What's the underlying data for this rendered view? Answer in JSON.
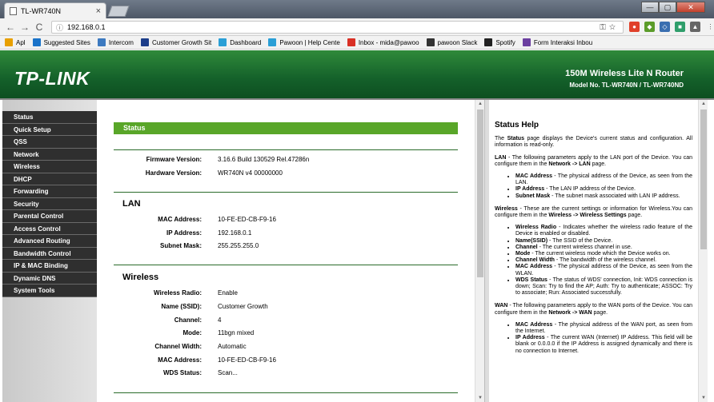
{
  "browser": {
    "tab_title": "TL-WR740N",
    "tab_close": "×",
    "url": "192.168.0.1",
    "win_min": "—",
    "win_max": "▢",
    "win_close": "✕",
    "bookmarks": [
      {
        "label": "Apl",
        "color": "#e8a000"
      },
      {
        "label": "Suggested Sites",
        "color": "#1a73c9"
      },
      {
        "label": "Intercom",
        "color": "#3d7ac0"
      },
      {
        "label": "Customer Growth Sit",
        "color": "#1d3e8a"
      },
      {
        "label": "Dashboard",
        "color": "#2a9fd6"
      },
      {
        "label": "Pawoon | Help Cente",
        "color": "#2a9fd6"
      },
      {
        "label": "Inbox - mida@pawoo",
        "color": "#d93025"
      },
      {
        "label": "pawoon Slack",
        "color": "#333333"
      },
      {
        "label": "Spotify",
        "color": "#222222"
      },
      {
        "label": "Form Interaksi Inbou",
        "color": "#6b3fa0"
      }
    ]
  },
  "header": {
    "logo": "TP-LINK",
    "model_line1": "150M Wireless Lite N Router",
    "model_line2": "Model No. TL-WR740N / TL-WR740ND"
  },
  "menu": [
    "Status",
    "Quick Setup",
    "QSS",
    "Network",
    "Wireless",
    "DHCP",
    "Forwarding",
    "Security",
    "Parental Control",
    "Access Control",
    "Advanced Routing",
    "Bandwidth Control",
    "IP & MAC Binding",
    "Dynamic DNS",
    "System Tools"
  ],
  "main": {
    "title": "Status",
    "firmware_label": "Firmware Version:",
    "firmware_value": "3.16.6 Build 130529 Rel.47286n",
    "hardware_label": "Hardware Version:",
    "hardware_value": "WR740N v4 00000000",
    "lan": {
      "title": "LAN",
      "mac_label": "MAC Address:",
      "mac_value": "10-FE-ED-CB-F9-16",
      "ip_label": "IP Address:",
      "ip_value": "192.168.0.1",
      "mask_label": "Subnet Mask:",
      "mask_value": "255.255.255.0"
    },
    "wireless": {
      "title": "Wireless",
      "radio_label": "Wireless Radio:",
      "radio_value": "Enable",
      "ssid_label": "Name (SSID):",
      "ssid_value": "Customer Growth",
      "channel_label": "Channel:",
      "channel_value": "4",
      "mode_label": "Mode:",
      "mode_value": "11bgn mixed",
      "width_label": "Channel Width:",
      "width_value": "Automatic",
      "mac_label": "MAC Address:",
      "mac_value": "10-FE-ED-CB-F9-16",
      "wds_label": "WDS Status:",
      "wds_value": "Scan..."
    }
  },
  "help": {
    "title": "Status Help",
    "intro_pre": "The ",
    "intro_bold": "Status",
    "intro_post": " page displays the Device's current status and configuration. All information is read-only.",
    "lan_pre": "LAN",
    "lan_text": " - The following parameters apply to the LAN port of the Device. You can configure them in the ",
    "lan_link": "Network -> LAN",
    "lan_end": " page.",
    "lan_items": [
      {
        "b": "MAC Address",
        "t": " - The physical address of the Device, as seen from the LAN."
      },
      {
        "b": "IP Address",
        "t": " - The LAN IP address of the Device."
      },
      {
        "b": "Subnet Mask",
        "t": " - The subnet mask associated with LAN IP address."
      }
    ],
    "wl_pre": "Wireless",
    "wl_text": " - These are the current settings or information for Wireless.You can configure them in the ",
    "wl_link": "Wireless -> Wireless Settings",
    "wl_end": " page.",
    "wl_items": [
      {
        "b": "Wireless Radio",
        "t": " - Indicates whether the wireless radio feature of the Device is enabled or disabled."
      },
      {
        "b": "Name(SSID)",
        "t": " - The SSID of the Device."
      },
      {
        "b": "Channel",
        "t": " - The current wireless channel in use."
      },
      {
        "b": "Mode",
        "t": " - The current wireless mode which the Device works on."
      },
      {
        "b": "Channel Width",
        "t": " - The bandwidth of the wireless channel."
      },
      {
        "b": "MAC Address",
        "t": " - The physical address of the Device, as seen from the WLAN."
      },
      {
        "b": "WDS Status",
        "t": " - The status of WDS' connection, Init: WDS connection is down; Scan: Try to find the AP; Auth: Try to authenticate; ASSOC: Try to associate; Run: Associated successfully."
      }
    ],
    "wan_pre": "WAN",
    "wan_text": " - The following parameters apply to the WAN ports of the Device. You can configure them in the ",
    "wan_link": "Network -> WAN",
    "wan_end": " page.",
    "wan_items": [
      {
        "b": "MAC Address",
        "t": " - The physical address of the WAN port, as seen from the Internet."
      },
      {
        "b": "IP Address",
        "t": " - The current WAN (Internet) IP Address. This field will be blank or 0.0.0.0 if the IP Address is assigned dynamically and there is no connection to Internet."
      }
    ]
  }
}
